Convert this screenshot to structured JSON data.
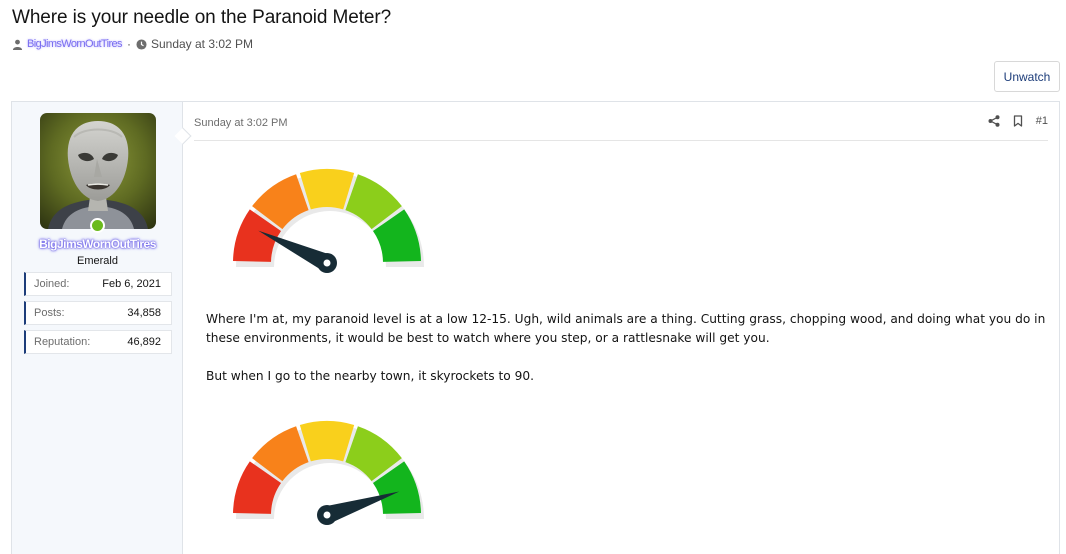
{
  "thread": {
    "title": "Where is your needle on the Paranoid Meter?",
    "author": "BigJimsWornOutTires",
    "date": "Sunday at 3:02 PM",
    "watch_label": "Unwatch"
  },
  "user": {
    "name": "BigJimsWornOutTires",
    "title": "Emerald",
    "online": true,
    "stats": [
      {
        "key": "Joined:",
        "value": "Feb 6, 2021"
      },
      {
        "key": "Posts:",
        "value": "34,858"
      },
      {
        "key": "Reputation:",
        "value": "46,892"
      }
    ]
  },
  "post": {
    "date": "Sunday at 3:02 PM",
    "number": "#1",
    "paragraphs": [
      "Where I'm at, my paranoid level is at a low 12-15. Ugh, wild animals are a thing. Cutting grass, chopping wood, and doing what you do in these environments, it would be best to watch where you step, or a rattlesnake will get you.",
      "But when I go to the nearby town, it skyrockets to 90."
    ],
    "gauges": [
      {
        "level": 14
      },
      {
        "level": 90
      }
    ]
  },
  "icons": {
    "author": "user-icon",
    "time": "clock-icon",
    "share": "share-icon",
    "bookmark": "bookmark-icon"
  },
  "colors": {
    "gauge_segments": [
      "#e8321e",
      "#f8821a",
      "#f9d01c",
      "#8cce1b",
      "#13b51d"
    ],
    "needle": "#172c36",
    "online": "#6aba1c"
  }
}
